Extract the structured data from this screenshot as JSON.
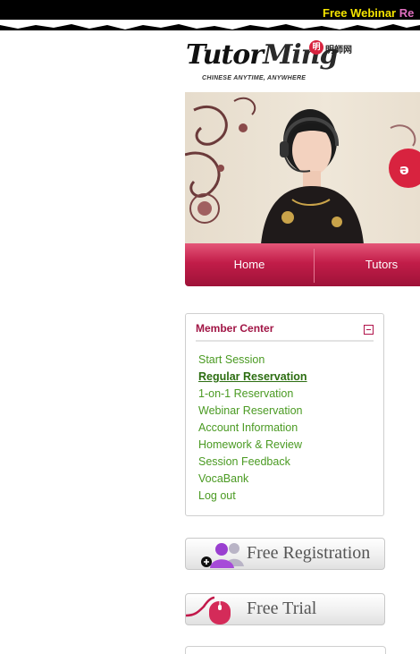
{
  "promo_bar": {
    "highlight": "Free Webinar",
    "trail": "Re"
  },
  "logo": {
    "name_left": "Tutor",
    "name_right": "Ming",
    "tagline": "CHINESE ANYTIME, ANYWHERE",
    "badge": "明",
    "chinese_name": "明師网"
  },
  "nav": {
    "items": [
      "Home",
      "Tutors"
    ]
  },
  "member_center": {
    "title": "Member Center",
    "links": [
      "Start Session",
      "Regular Reservation",
      "1-on-1 Reservation",
      "Webinar Reservation",
      "Account Information",
      "Homework & Review",
      "Session Feedback",
      "VocaBank",
      "Log out"
    ],
    "active_index": 1
  },
  "buttons": {
    "free_registration": "Free Registration",
    "free_trial": "Free Trial"
  },
  "colors": {
    "nav_crimson": "#c21d49",
    "member_title": "#a11545",
    "link_green": "#4a9a22",
    "promo_yellow": "#f5e400"
  }
}
